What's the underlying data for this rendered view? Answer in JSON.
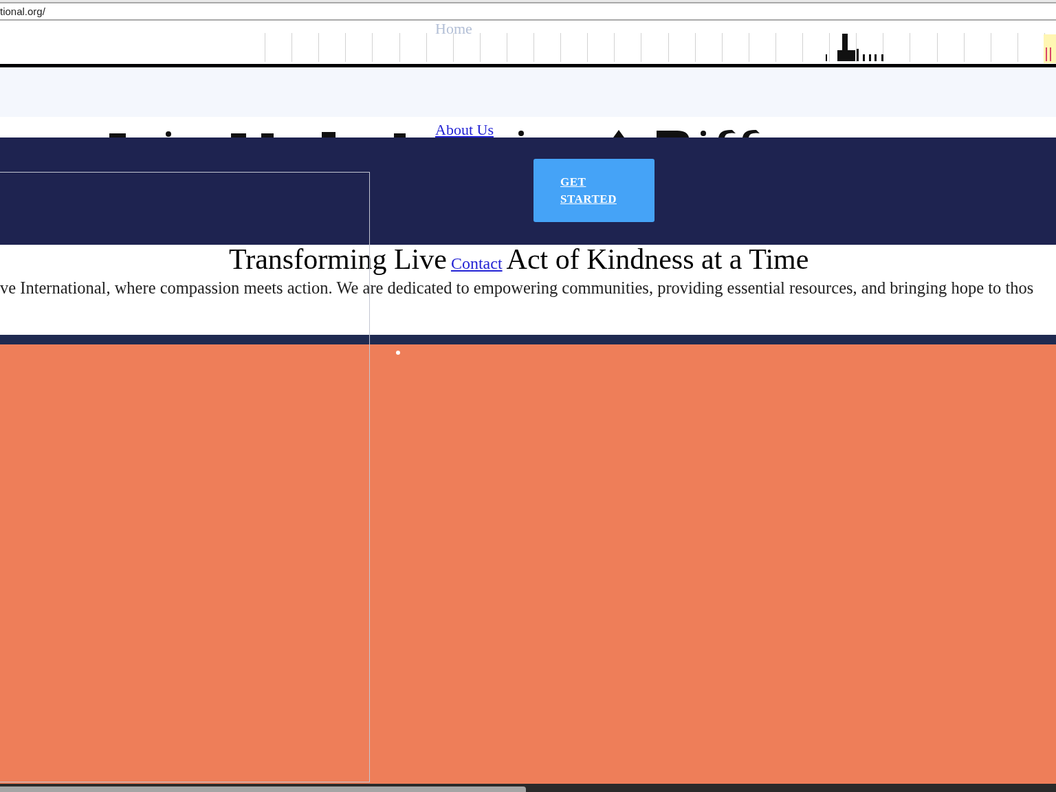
{
  "address_bar": {
    "url": "tional.org/"
  },
  "nav": [
    {
      "label": "Home",
      "kind": "faint"
    },
    {
      "label": "About Us",
      "kind": "link"
    }
  ],
  "hero": {
    "button": "GET STARTED",
    "subheading": [
      {
        "kind": "text",
        "text": "Transforming Live"
      },
      {
        "kind": "link",
        "text": "Contact"
      },
      {
        "kind": "text",
        "text": "Act of Kindness at a Time"
      }
    ],
    "paragraph": "ve International, where compassion meets action. We are dedicated to empowering communities, providing essential resources, and bringing hope to thos"
  }
}
